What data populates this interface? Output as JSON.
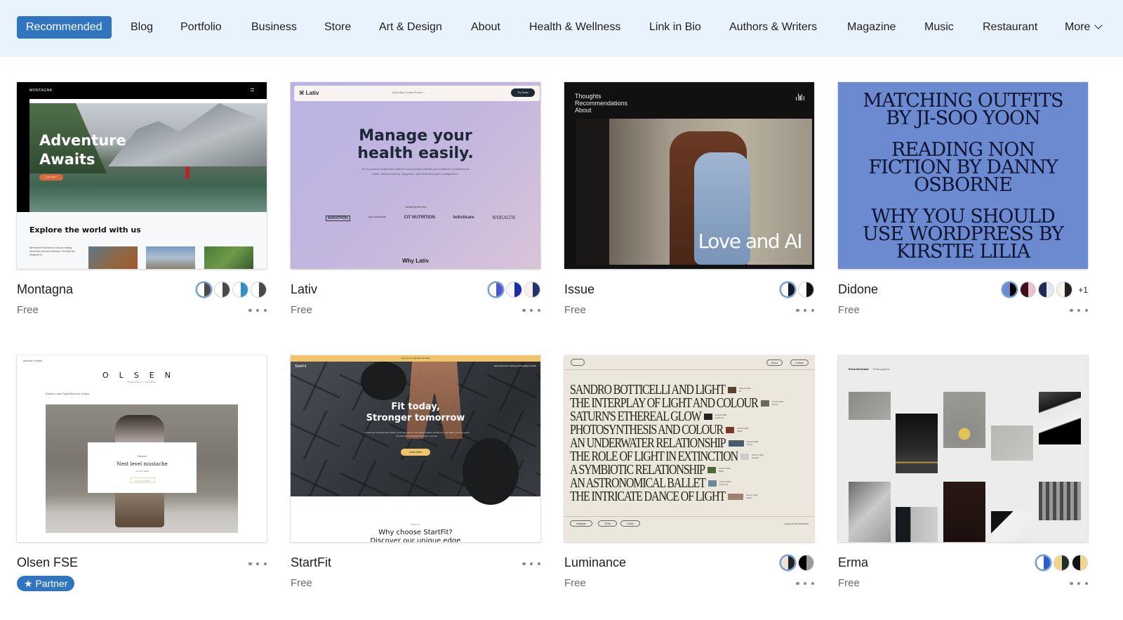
{
  "nav": {
    "items": [
      {
        "label": "Recommended",
        "active": true
      },
      {
        "label": "Blog"
      },
      {
        "label": "Portfolio"
      },
      {
        "label": "Business"
      },
      {
        "label": "Store"
      },
      {
        "label": "Art & Design"
      },
      {
        "label": "About"
      },
      {
        "label": "Health & Wellness"
      },
      {
        "label": "Link in Bio"
      },
      {
        "label": "Authors & Writers"
      },
      {
        "label": "Magazine"
      },
      {
        "label": "Music"
      },
      {
        "label": "Restaurant"
      },
      {
        "label": "More"
      }
    ],
    "accent_color": "#3174c0",
    "background_color": "#e9f3fd"
  },
  "themes": [
    {
      "name": "Montagna",
      "price": "Free",
      "swatches": [
        [
          "#ffffff",
          "#4a4a4a"
        ],
        [
          "#ffffff",
          "#4a4a4a"
        ],
        [
          "#ffffff",
          "#2e90c8"
        ],
        [
          "#ffffff",
          "#4a4a4a"
        ]
      ],
      "preview": {
        "logo": "MONTAGNA",
        "headline_1": "Adventure",
        "headline_2": "Awaits",
        "button": "Learn More",
        "subheading": "Explore the world with us",
        "body": "We believe that travel is about creating memories that last a lifetime. Our trips are designed to"
      }
    },
    {
      "name": "Lativ",
      "price": "Free",
      "swatches": [
        [
          "#ffffff",
          "#4b55d1"
        ],
        [
          "#f5f8fd",
          "#1c2fa8"
        ],
        [
          "#fbf0ec",
          "#25336b"
        ]
      ],
      "preview": {
        "logo": "Lativ",
        "links": "About  Blog  Contact  Product ⌄",
        "button": "Try Demo",
        "headline_1": "Manage your",
        "headline_2": "health easily.",
        "body": "An AI-powered healthcare platform that provides patients and healthcare professionals better medical records, diagnoses, and treatment plans management.",
        "trusted": "Trusted by the best",
        "logos": [
          "MARATHON",
          "NEW HAMPSHIRE",
          "CIT NUTRITION",
          "holisticare",
          "WHEALTH"
        ],
        "footer": "Why Lativ"
      }
    },
    {
      "name": "Issue",
      "price": "Free",
      "swatches": [
        [
          "#ffffff",
          "#0e1a2e"
        ],
        [
          "#ffffff",
          "#111111"
        ]
      ],
      "preview": {
        "nav": [
          "Thoughts",
          "Recommendations",
          "About"
        ],
        "headline": "Love and AI"
      }
    },
    {
      "name": "Didone",
      "price": "Free",
      "swatches": [
        [
          "#6b8ad0",
          "#000000"
        ],
        [
          "#3c0f1a",
          "#e9c2cf"
        ],
        [
          "#1d2a55",
          "#e6e8ee"
        ],
        [
          "#f7f3e8",
          "#222222"
        ]
      ],
      "extra_swatches": "+1",
      "preview": {
        "posts": [
          "MATCHING OUTFITS BY JI-SOO YOON",
          "READING NON FICTION BY DANNY OSBORNE",
          "WHY YOU SHOULD USE WORDPRESS BY KIRSTIE LILIA"
        ]
      }
    },
    {
      "name": "Olsen FSE",
      "badge": "Partner",
      "preview": {
        "top_links": "Aboutme   Contact",
        "logo": "OLSEN",
        "tagline": "Blogging theme for WordPress",
        "menu": "Fashion   Looks   Travel   About me   Contact",
        "category": "Fashion",
        "post_title": "Next level mustache",
        "date": "April 25, 2023",
        "link": "Continue Reading"
      }
    },
    {
      "name": "StartFit",
      "price": "Free",
      "preview": {
        "banner": "Sign up for a 30-day trial today",
        "logo": "StartFit",
        "nav": "Home   Personal Training   Pricing   Blog   Contact",
        "headline_1": "Fit today,",
        "headline_2": "Stronger tomorrow",
        "body": "Unlock your potential and redefine your limits with us. Our training tailors solutions to your ability, ensuring you're fit today and unstoppably stronger tomorrow.",
        "button": "Learn More",
        "about": "ABOUT US",
        "why_1": "Why choose StartFit?",
        "why_2": "Discover our unique edge"
      }
    },
    {
      "name": "Luminance",
      "price": "Free",
      "swatches": [
        [
          "#e9e4d8",
          "#222222"
        ],
        [
          "#000000",
          "#9a9a9a"
        ]
      ],
      "preview": {
        "nav": [
          "About",
          "Contact"
        ],
        "posts": [
          {
            "title": "SANDRO BOTTICELLI AND LIGHT",
            "date": "June 29, 2023",
            "cat": "Art"
          },
          {
            "title": "THE INTERPLAY OF LIGHT AND COLOUR",
            "date": "June 29, 2023",
            "cat": "Animal"
          },
          {
            "title": "SATURN'S ETHEREAL GLOW",
            "date": "June 28, 2023",
            "cat": "Astronomy"
          },
          {
            "title": "PHOTOSYNTHESIS AND COLOUR",
            "date": "June 28, 2023",
            "cat": "Plants"
          },
          {
            "title": "AN UNDERWATER RELATIONSHIP",
            "date": "June 28, 2023",
            "cat": "Animal"
          },
          {
            "title": "THE ROLE OF LIGHT IN EXTINCTION",
            "date": "June 27, 2023",
            "cat": "Dinosaur"
          },
          {
            "title": "A SYMBIOTIC RELATIONSHIP",
            "date": "June 27, 2023",
            "cat": "Plants"
          },
          {
            "title": "AN ASTRONOMICAL BALLET",
            "date": "June 27, 2023",
            "cat": "Astronomy"
          },
          {
            "title": "THE INTRICATE DANCE OF LIGHT",
            "date": "June 27, 2023",
            "cat": "Animal"
          }
        ],
        "footer_links": [
          "Instagram",
          "TikTok",
          "Tumblr"
        ],
        "credit": "Designed with WordPress"
      }
    },
    {
      "name": "Erma",
      "price": "Free",
      "swatches": [
        [
          "#ffffff",
          "#2a5bd7"
        ],
        [
          "#f1d58a",
          "#1f2e2a"
        ],
        [
          "#111111",
          "#f1d58a"
        ]
      ],
      "preview": {
        "name": "Erma Normand",
        "role": "Photographer"
      }
    }
  ]
}
